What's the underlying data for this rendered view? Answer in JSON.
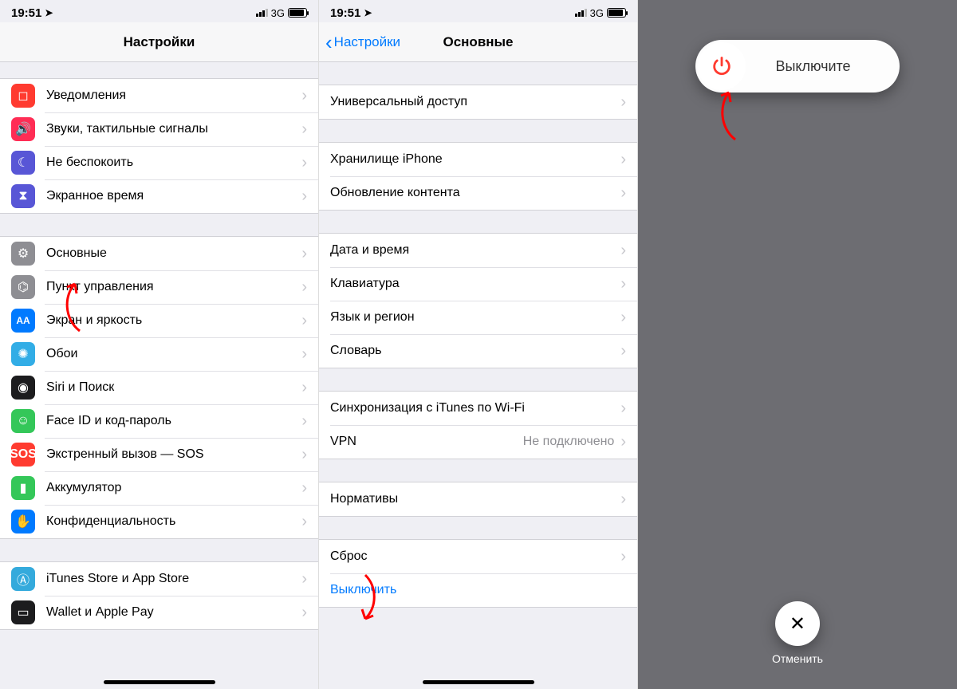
{
  "status": {
    "time": "19:51",
    "network": "3G"
  },
  "pane1": {
    "title": "Настройки",
    "group1": [
      {
        "icon": "bell-icon",
        "bg": "ic-red",
        "label": "Уведомления"
      },
      {
        "icon": "speaker-icon",
        "bg": "ic-pink",
        "label": "Звуки, тактильные сигналы"
      },
      {
        "icon": "moon-icon",
        "bg": "ic-purple",
        "label": "Не беспокоить"
      },
      {
        "icon": "hourglass-icon",
        "bg": "ic-indigo",
        "label": "Экранное время"
      }
    ],
    "group2": [
      {
        "icon": "gear-icon",
        "bg": "ic-grey",
        "label": "Основные"
      },
      {
        "icon": "switches-icon",
        "bg": "ic-grey",
        "label": "Пункт управления"
      },
      {
        "icon": "aa-icon",
        "bg": "ic-blue",
        "label": "Экран и яркость"
      },
      {
        "icon": "atom-icon",
        "bg": "ic-atom",
        "label": "Обои"
      },
      {
        "icon": "siri-icon",
        "bg": "ic-black",
        "label": "Siri и Поиск"
      },
      {
        "icon": "faceid-icon",
        "bg": "ic-green",
        "label": "Face ID и код-пароль"
      },
      {
        "icon": "sos-icon",
        "bg": "ic-sos",
        "label": "Экстренный вызов — SOS"
      },
      {
        "icon": "battery-icon",
        "bg": "ic-green",
        "label": "Аккумулятор"
      },
      {
        "icon": "hand-icon",
        "bg": "ic-blue",
        "label": "Конфиденциальность"
      }
    ],
    "group3": [
      {
        "icon": "appstore-icon",
        "bg": "ic-lightblue",
        "label": "iTunes Store и App Store"
      },
      {
        "icon": "wallet-icon",
        "bg": "ic-black",
        "label": "Wallet и Apple Pay"
      }
    ]
  },
  "pane2": {
    "back": "Настройки",
    "title": "Основные",
    "group1": [
      {
        "label": "Универсальный доступ"
      }
    ],
    "group2": [
      {
        "label": "Хранилище iPhone"
      },
      {
        "label": "Обновление контента"
      }
    ],
    "group3": [
      {
        "label": "Дата и время"
      },
      {
        "label": "Клавиатура"
      },
      {
        "label": "Язык и регион"
      },
      {
        "label": "Словарь"
      }
    ],
    "group4": [
      {
        "label": "Синхронизация с iTunes по Wi-Fi"
      },
      {
        "label": "VPN",
        "value": "Не подключено"
      }
    ],
    "group5": [
      {
        "label": "Нормативы"
      }
    ],
    "group6": [
      {
        "label": "Сброс"
      },
      {
        "label": "Выключить",
        "link": true
      }
    ]
  },
  "pane3": {
    "slide_label": "Выключите",
    "cancel_label": "Отменить"
  }
}
